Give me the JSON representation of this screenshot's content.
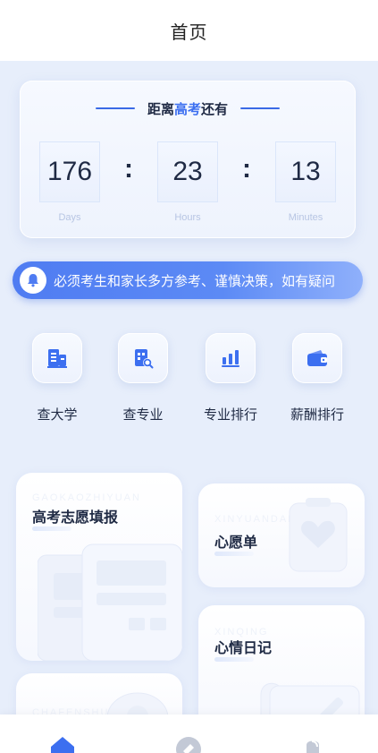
{
  "header": {
    "title": "首页"
  },
  "countdown": {
    "title_prefix": "距离",
    "title_highlight": "高考",
    "title_suffix": "还有",
    "days": "176",
    "hours": "23",
    "minutes": "13",
    "colon": ":",
    "days_label": "Days",
    "hours_label": "Hours",
    "minutes_label": "Minutes"
  },
  "notice": {
    "text": "必须考生和家长多方参考、谨慎决策，如有疑问"
  },
  "quick_links": [
    {
      "label": "查大学",
      "icon": "university-icon"
    },
    {
      "label": "查专业",
      "icon": "major-search-icon"
    },
    {
      "label": "专业排行",
      "icon": "bar-chart-icon"
    },
    {
      "label": "薪酬排行",
      "icon": "wallet-icon"
    }
  ],
  "features": {
    "volunteer": {
      "title": "高考志愿填报",
      "ghost": "GAOKAOZHIYUAN"
    },
    "wishlist": {
      "title": "心愿单",
      "ghost": "XINYUANDAN"
    },
    "mood": {
      "title": "心情日记",
      "ghost": "XINQING"
    },
    "extra": {
      "ghost": "CHAFENSHU"
    }
  },
  "tabbar": {
    "items": [
      {
        "icon": "home-icon",
        "active": true
      },
      {
        "icon": "compass-icon",
        "active": false
      },
      {
        "icon": "user-icon",
        "active": false
      }
    ]
  },
  "colors": {
    "accent": "#3c6ff0",
    "background": "#e7eefb",
    "text": "#1f2a44"
  }
}
